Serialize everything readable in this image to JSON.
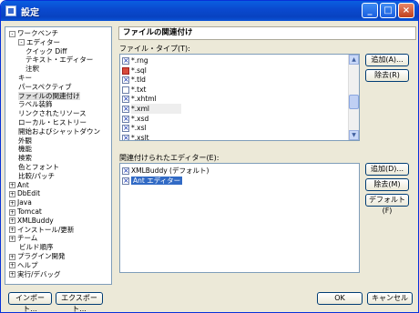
{
  "window": {
    "title": "設定"
  },
  "titlebar_buttons": [
    "_",
    "□",
    "×"
  ],
  "tree": {
    "items": [
      {
        "label": "ワークベンチ",
        "expander": "-",
        "level": 0
      },
      {
        "label": "エディター",
        "expander": "-",
        "level": 1
      },
      {
        "label": "クイック Diff",
        "level": 2
      },
      {
        "label": "テキスト・エディター",
        "level": 2
      },
      {
        "label": "注釈",
        "level": 2
      },
      {
        "label": "キー",
        "level": 1
      },
      {
        "label": "パースペクティブ",
        "level": 1
      },
      {
        "label": "ファイルの関連付け",
        "level": 1,
        "selected": true
      },
      {
        "label": "ラベル装飾",
        "level": 1
      },
      {
        "label": "リンクされたリソース",
        "level": 1
      },
      {
        "label": "ローカル・ヒストリー",
        "level": 1
      },
      {
        "label": "開始およびシャットダウン",
        "level": 1
      },
      {
        "label": "外観",
        "level": 1
      },
      {
        "label": "機能",
        "level": 1
      },
      {
        "label": "検索",
        "level": 1
      },
      {
        "label": "色とフォント",
        "level": 1
      },
      {
        "label": "比較/パッチ",
        "level": 1
      },
      {
        "label": "Ant",
        "expander": "+",
        "level": 0
      },
      {
        "label": "DbEdit",
        "expander": "+",
        "level": 0
      },
      {
        "label": "Java",
        "expander": "+",
        "level": 0
      },
      {
        "label": "Tomcat",
        "expander": "+",
        "level": 0
      },
      {
        "label": "XMLBuddy",
        "expander": "+",
        "level": 0
      },
      {
        "label": "インストール/更新",
        "expander": "+",
        "level": 0
      },
      {
        "label": "チーム",
        "expander": "+",
        "level": 0
      },
      {
        "label": "ビルド順序",
        "level": 0
      },
      {
        "label": "プラグイン開発",
        "expander": "+",
        "level": 0
      },
      {
        "label": "ヘルプ",
        "expander": "+",
        "level": 0
      },
      {
        "label": "実行/デバッグ",
        "expander": "+",
        "level": 0
      }
    ]
  },
  "page_title": "ファイルの関連付け",
  "file_types": {
    "label": "ファイル・タイプ(T):",
    "items": [
      {
        "text": "*.rng",
        "icon": "x"
      },
      {
        "text": "*.sql",
        "icon": "red"
      },
      {
        "text": "*.tld",
        "icon": "x"
      },
      {
        "text": "*.txt",
        "icon": "plain"
      },
      {
        "text": "*.xhtml",
        "icon": "x"
      },
      {
        "text": "*.xml",
        "icon": "x",
        "highlight": true
      },
      {
        "text": "*.xsd",
        "icon": "x"
      },
      {
        "text": "*.xsl",
        "icon": "x"
      },
      {
        "text": "*.xslt",
        "icon": "x"
      }
    ],
    "add_button": "追加(A)...",
    "remove_button": "除去(R)"
  },
  "editors": {
    "label": "関連付けられたエディター(E):",
    "items": [
      {
        "text": "XMLBuddy (デフォルト)",
        "icon": "x"
      },
      {
        "text": "Ant エディター",
        "icon": "x",
        "selected": true
      }
    ],
    "add_button": "追加(D)...",
    "remove_button": "除去(M)",
    "default_button": "デフォルト(F)"
  },
  "footer": {
    "import_button": "インポート...",
    "export_button": "エクスポート...",
    "ok_button": "OK",
    "cancel_button": "キャンセル"
  }
}
